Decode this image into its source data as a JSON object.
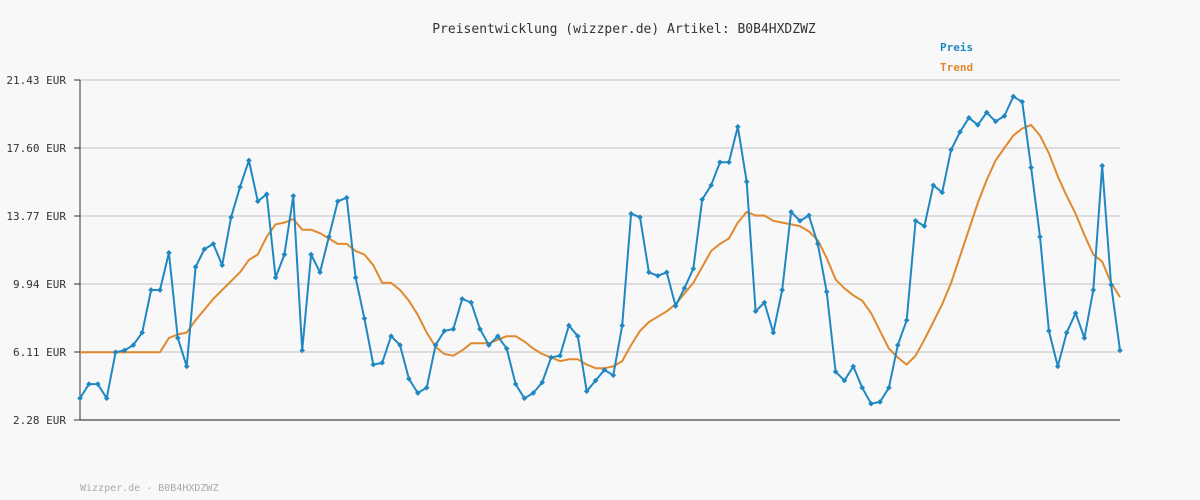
{
  "chart_data": {
    "type": "line",
    "title": "Preisentwicklung (wizzper.de) Artikel: B0B4HXDZWZ",
    "footer": "Wizzper.de - B0B4HXDZWZ",
    "ylim": [
      2.28,
      21.43
    ],
    "yticks": [
      "21.43 EUR",
      "17.60 EUR",
      "13.77 EUR",
      "9.94 EUR",
      "6.11 EUR",
      "2.28 EUR"
    ],
    "ytick_values": [
      21.43,
      17.6,
      13.77,
      9.94,
      6.11,
      2.28
    ],
    "grid": true,
    "legend_position": "top-right",
    "series": [
      {
        "name": "Preis",
        "color": "#1f88c2",
        "values": [
          3.5,
          4.3,
          4.3,
          3.5,
          6.1,
          6.2,
          6.5,
          7.2,
          9.6,
          9.6,
          11.7,
          6.9,
          5.3,
          10.9,
          11.9,
          12.2,
          11.0,
          13.7,
          15.4,
          16.9,
          14.6,
          15.0,
          10.3,
          11.6,
          14.9,
          6.2,
          11.6,
          10.6,
          12.6,
          14.6,
          14.8,
          10.3,
          8.0,
          5.4,
          5.5,
          7.0,
          6.5,
          4.6,
          3.8,
          4.1,
          6.5,
          7.3,
          7.4,
          9.1,
          8.9,
          7.4,
          6.5,
          7.0,
          6.3,
          4.3,
          3.5,
          3.8,
          4.4,
          5.8,
          5.9,
          7.6,
          7.0,
          3.9,
          4.5,
          5.1,
          4.8,
          7.6,
          13.9,
          13.7,
          10.6,
          10.4,
          10.6,
          8.7,
          9.7,
          10.8,
          14.7,
          15.5,
          16.8,
          16.8,
          18.8,
          15.7,
          8.4,
          8.9,
          7.2,
          9.6,
          14.0,
          13.5,
          13.8,
          12.2,
          9.5,
          5.0,
          4.5,
          5.3,
          4.1,
          3.2,
          3.3,
          4.1,
          6.5,
          7.9,
          13.5,
          13.2,
          15.5,
          15.1,
          17.5,
          18.5,
          19.3,
          18.9,
          19.6,
          19.1,
          19.4,
          20.5,
          20.2,
          16.5,
          12.6,
          7.3,
          5.3,
          7.2,
          8.3,
          6.9,
          9.6,
          16.6,
          9.9,
          6.2
        ]
      },
      {
        "name": "Trend",
        "color": "#e0892e",
        "values": [
          6.1,
          6.1,
          6.1,
          6.1,
          6.1,
          6.1,
          6.1,
          6.1,
          6.1,
          6.1,
          6.9,
          7.1,
          7.2,
          7.9,
          8.5,
          9.1,
          9.6,
          10.1,
          10.6,
          11.3,
          11.6,
          12.6,
          13.3,
          13.4,
          13.6,
          13.0,
          13.0,
          12.8,
          12.5,
          12.2,
          12.2,
          11.8,
          11.6,
          11.0,
          10.0,
          10.0,
          9.6,
          9.0,
          8.2,
          7.2,
          6.4,
          6.0,
          5.9,
          6.2,
          6.6,
          6.6,
          6.6,
          6.8,
          7.0,
          7.0,
          6.7,
          6.3,
          6.0,
          5.8,
          5.6,
          5.7,
          5.7,
          5.4,
          5.2,
          5.2,
          5.3,
          5.6,
          6.5,
          7.3,
          7.8,
          8.1,
          8.4,
          8.8,
          9.4,
          10.0,
          10.9,
          11.8,
          12.2,
          12.5,
          13.4,
          14.0,
          13.8,
          13.8,
          13.5,
          13.4,
          13.3,
          13.2,
          12.9,
          12.4,
          11.4,
          10.2,
          9.7,
          9.3,
          9.0,
          8.3,
          7.3,
          6.3,
          5.8,
          5.4,
          5.9,
          6.8,
          7.8,
          8.8,
          10.0,
          11.5,
          13.0,
          14.5,
          15.8,
          16.9,
          17.6,
          18.3,
          18.7,
          18.9,
          18.3,
          17.3,
          16.0,
          14.9,
          13.9,
          12.7,
          11.6,
          11.2,
          10.0,
          9.2
        ]
      }
    ]
  }
}
